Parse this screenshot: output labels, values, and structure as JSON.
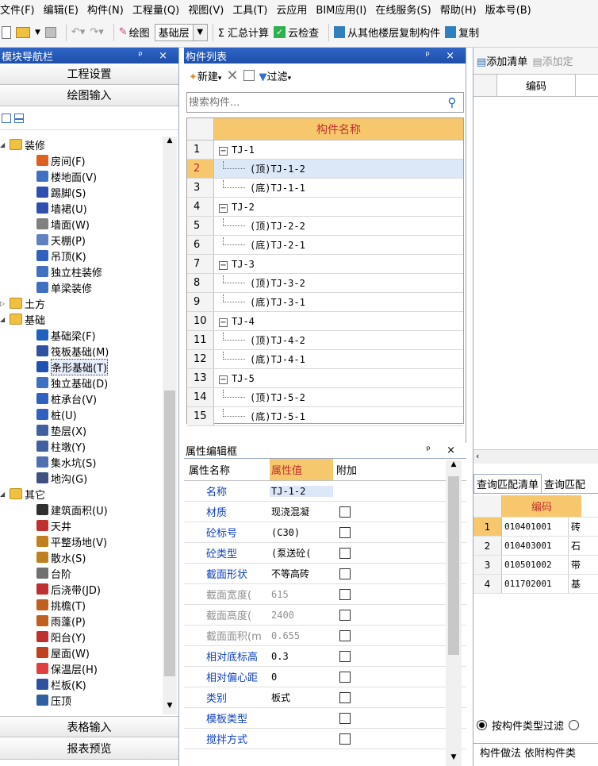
{
  "menu": [
    "文件(F)",
    "编辑(E)",
    "构件(N)",
    "工程量(Q)",
    "视图(V)",
    "工具(T)",
    "云应用",
    "BIM应用(I)",
    "在线服务(S)",
    "帮助(H)",
    "版本号(B)"
  ],
  "toolbar": {
    "draw_label": "绘图",
    "floor_value": "基础层",
    "sum_label": "Σ 汇总计算",
    "cloud_check_label": "云检查",
    "copy_from_other_label": "从其他楼层复制构件",
    "copy_label": "复制"
  },
  "nav": {
    "title": "模块导航栏",
    "title_ctl": "ᵖ ×",
    "btn_project": "工程设置",
    "btn_draw": "绘图输入",
    "btn_table": "表格输入",
    "btn_report": "报表预览",
    "tree": [
      {
        "label": "装修",
        "level": 0,
        "folder": true,
        "open": true
      },
      {
        "label": "房间(F)",
        "level": 1,
        "color": "#e06020"
      },
      {
        "label": "楼地面(V)",
        "level": 1,
        "color": "#4070c0"
      },
      {
        "label": "踢脚(S)",
        "level": 1,
        "color": "#3050b0"
      },
      {
        "label": "墙裙(U)",
        "level": 1,
        "color": "#3050b0"
      },
      {
        "label": "墙面(W)",
        "level": 1,
        "color": "#808080"
      },
      {
        "label": "天棚(P)",
        "level": 1,
        "color": "#6080c0"
      },
      {
        "label": "吊顶(K)",
        "level": 1,
        "color": "#3060c0"
      },
      {
        "label": "独立柱装修",
        "level": 1,
        "color": "#4070c0"
      },
      {
        "label": "单梁装修",
        "level": 1,
        "color": "#4070c0"
      },
      {
        "label": "土方",
        "level": 0,
        "folder": true,
        "open": false
      },
      {
        "label": "基础",
        "level": 0,
        "folder": true,
        "open": true
      },
      {
        "label": "基础梁(F)",
        "level": 1,
        "color": "#2060c0"
      },
      {
        "label": "筏板基础(M)",
        "level": 1,
        "color": "#3050a0"
      },
      {
        "label": "条形基础(T)",
        "level": 1,
        "color": "#2050b0",
        "selected": true
      },
      {
        "label": "独立基础(D)",
        "level": 1,
        "color": "#4070c0"
      },
      {
        "label": "桩承台(V)",
        "level": 1,
        "color": "#3060c0"
      },
      {
        "label": "桩(U)",
        "level": 1,
        "color": "#3060c0"
      },
      {
        "label": "垫层(X)",
        "level": 1,
        "color": "#4060a0"
      },
      {
        "label": "柱墩(Y)",
        "level": 1,
        "color": "#4060a0"
      },
      {
        "label": "集水坑(S)",
        "level": 1,
        "color": "#5070b0"
      },
      {
        "label": "地沟(G)",
        "level": 1,
        "color": "#405080"
      },
      {
        "label": "其它",
        "level": 0,
        "folder": true,
        "open": true
      },
      {
        "label": "建筑面积(U)",
        "level": 1,
        "color": "#303030"
      },
      {
        "label": "天井",
        "level": 1,
        "color": "#c03030"
      },
      {
        "label": "平整场地(V)",
        "level": 1,
        "color": "#c08020"
      },
      {
        "label": "散水(S)",
        "level": 1,
        "color": "#c08020"
      },
      {
        "label": "台阶",
        "level": 1,
        "color": "#707070"
      },
      {
        "label": "后浇带(JD)",
        "level": 1,
        "color": "#c03030"
      },
      {
        "label": "挑檐(T)",
        "level": 1,
        "color": "#c06020"
      },
      {
        "label": "雨蓬(P)",
        "level": 1,
        "color": "#c06020"
      },
      {
        "label": "阳台(Y)",
        "level": 1,
        "color": "#c03030"
      },
      {
        "label": "屋面(W)",
        "level": 1,
        "color": "#c04020"
      },
      {
        "label": "保温层(H)",
        "level": 1,
        "color": "#e04040"
      },
      {
        "label": "栏板(K)",
        "level": 1,
        "color": "#3050a0"
      },
      {
        "label": "压顶",
        "level": 1,
        "color": "#3060a0"
      }
    ]
  },
  "comp": {
    "title": "构件列表",
    "title_ctl": "ᵖ ×",
    "new_label": "新建",
    "filter_label": "过滤",
    "search_placeholder": "搜索构件...",
    "col_header": "构件名称",
    "rows": [
      {
        "n": "1",
        "label": "TJ-1",
        "type": "parent"
      },
      {
        "n": "2",
        "label": "(顶)TJ-1-2",
        "type": "child",
        "selected": true
      },
      {
        "n": "3",
        "label": "(底)TJ-1-1",
        "type": "child"
      },
      {
        "n": "4",
        "label": "TJ-2",
        "type": "parent"
      },
      {
        "n": "5",
        "label": "(顶)TJ-2-2",
        "type": "child"
      },
      {
        "n": "6",
        "label": "(底)TJ-2-1",
        "type": "child"
      },
      {
        "n": "7",
        "label": "TJ-3",
        "type": "parent"
      },
      {
        "n": "8",
        "label": "(顶)TJ-3-2",
        "type": "child"
      },
      {
        "n": "9",
        "label": "(底)TJ-3-1",
        "type": "child"
      },
      {
        "n": "10",
        "label": "TJ-4",
        "type": "parent"
      },
      {
        "n": "11",
        "label": "(顶)TJ-4-2",
        "type": "child"
      },
      {
        "n": "12",
        "label": "(底)TJ-4-1",
        "type": "child"
      },
      {
        "n": "13",
        "label": "TJ-5",
        "type": "parent"
      },
      {
        "n": "14",
        "label": "(顶)TJ-5-2",
        "type": "child"
      },
      {
        "n": "15",
        "label": "(底)TJ-5-1",
        "type": "child"
      }
    ]
  },
  "prop": {
    "title": "属性编辑框",
    "title_ctl": "ᵖ ×",
    "h_name": "属性名称",
    "h_value": "属性值",
    "h_extra": "附加",
    "rows": [
      {
        "name": "名称",
        "value": "TJ-1-2",
        "gray": false,
        "cb": false
      },
      {
        "name": "材质",
        "value": "现浇混凝",
        "gray": false,
        "cb": true
      },
      {
        "name": "砼标号",
        "value": "(C30)",
        "gray": false,
        "cb": true
      },
      {
        "name": "砼类型",
        "value": "(泵送砼(",
        "gray": false,
        "cb": true
      },
      {
        "name": "截面形状",
        "value": "不等高砖",
        "gray": false,
        "cb": true
      },
      {
        "name": "截面宽度(",
        "value": "615",
        "gray": true,
        "cb": true
      },
      {
        "name": "截面高度(",
        "value": "2400",
        "gray": true,
        "cb": true
      },
      {
        "name": "截面面积(m",
        "value": "0.655",
        "gray": true,
        "cb": true
      },
      {
        "name": "相对底标高",
        "value": "0.3",
        "gray": false,
        "cb": true
      },
      {
        "name": "相对偏心距",
        "value": "0",
        "gray": false,
        "cb": true
      },
      {
        "name": "类别",
        "value": "板式",
        "gray": false,
        "cb": true
      },
      {
        "name": "模板类型",
        "value": "",
        "gray": false,
        "cb": true
      },
      {
        "name": "搅拌方式",
        "value": "",
        "gray": false,
        "cb": true
      }
    ]
  },
  "right": {
    "add_list_label": "添加清单",
    "add_quota_label": "添加定",
    "col_code": "编码",
    "tab1": "查询匹配清单",
    "tab2": "查询匹配",
    "match_header": "编码",
    "match_rows": [
      {
        "n": "1",
        "code": "010401001",
        "extra": "砖"
      },
      {
        "n": "2",
        "code": "010403001",
        "extra": "石"
      },
      {
        "n": "3",
        "code": "010501002",
        "extra": "带"
      },
      {
        "n": "4",
        "code": "011702001",
        "extra": "基"
      }
    ],
    "radio_label": "按构件类型过滤",
    "bottom_tab1": "构件做法",
    "bottom_tab2": "依附构件类"
  }
}
